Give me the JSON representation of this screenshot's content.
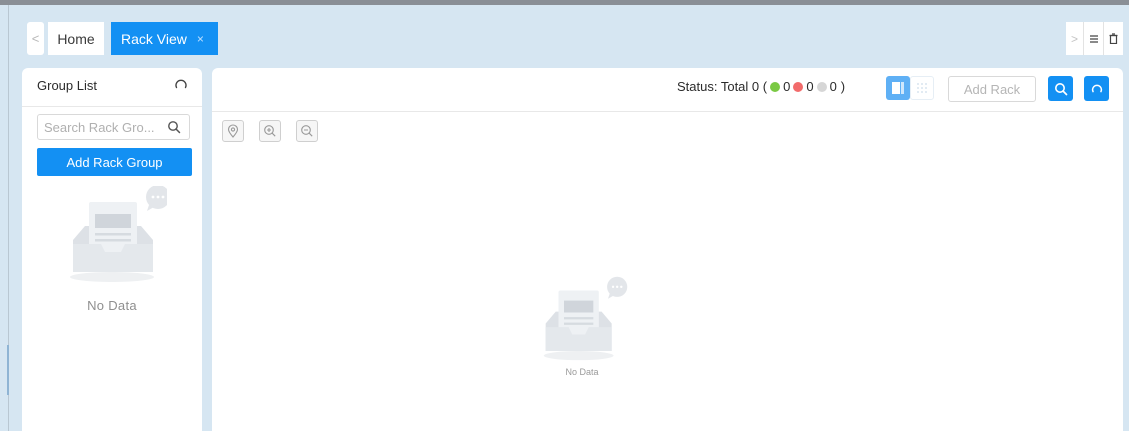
{
  "tabs": {
    "home": "Home",
    "active": "Rack View",
    "close": "×",
    "prev": "<",
    "next": ">"
  },
  "right_tools": {
    "menu_icon": "menu-icon",
    "trash_icon": "trash-icon"
  },
  "group_list": {
    "title": "Group List",
    "search_placeholder": "Search Rack Gro...",
    "add_button": "Add Rack Group",
    "empty_text": "No Data"
  },
  "main": {
    "status_label": "Status: Total 0 (",
    "status_green": "0",
    "status_red": "0",
    "status_gray": "0",
    "status_close": ")",
    "add_rack": "Add Rack",
    "empty_text": "No Data"
  },
  "colors": {
    "accent": "#1390f3",
    "green": "#7ac943",
    "red": "#f26b6b",
    "gray": "#d6d6d6"
  }
}
